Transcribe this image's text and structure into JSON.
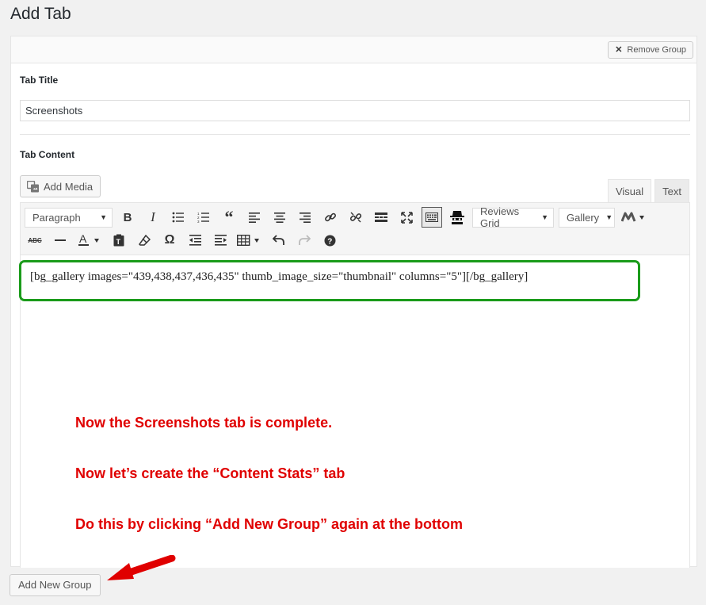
{
  "page": {
    "title": "Add Tab"
  },
  "group": {
    "remove_label": "Remove Group",
    "tab_title_label": "Tab Title",
    "tab_title_value": "Screenshots",
    "tab_content_label": "Tab Content",
    "add_media_label": "Add Media"
  },
  "editor": {
    "tabs": [
      "Visual",
      "Text"
    ],
    "active_tab": "Visual",
    "format_select": "Paragraph",
    "reviews_select": "Reviews Grid",
    "gallery_select": "Gallery",
    "toolbar_row1_icons": [
      "bold-icon",
      "italic-icon",
      "bullet-list-icon",
      "numbered-list-icon",
      "blockquote-icon",
      "align-left-icon",
      "align-center-icon",
      "align-right-icon",
      "insert-link-icon",
      "remove-link-icon",
      "read-more-icon",
      "fullscreen-icon",
      "toolbar-toggle-icon",
      "spy-icon"
    ],
    "toolbar_row2_icons": [
      "strikethrough-icon",
      "horizontal-line-icon",
      "text-color-icon",
      "paste-as-text-icon",
      "clear-formatting-icon",
      "special-character-icon",
      "decrease-indent-icon",
      "increase-indent-icon",
      "table-icon",
      "undo-icon",
      "redo-icon",
      "help-icon"
    ],
    "content": "[bg_gallery images=\"439,438,437,436,435\" thumb_image_size=\"thumbnail\" columns=\"5\"][/bg_gallery]"
  },
  "annotations": [
    "Now the Screenshots tab is complete.",
    "Now let’s create the “Content Stats” tab",
    "Do this by clicking “Add New Group” again at the bottom"
  ],
  "footer": {
    "add_group_label": "Add New Group"
  },
  "colors": {
    "annotation": "#e00000",
    "highlight": "#1a9b1a",
    "arrow": "#e00000"
  }
}
